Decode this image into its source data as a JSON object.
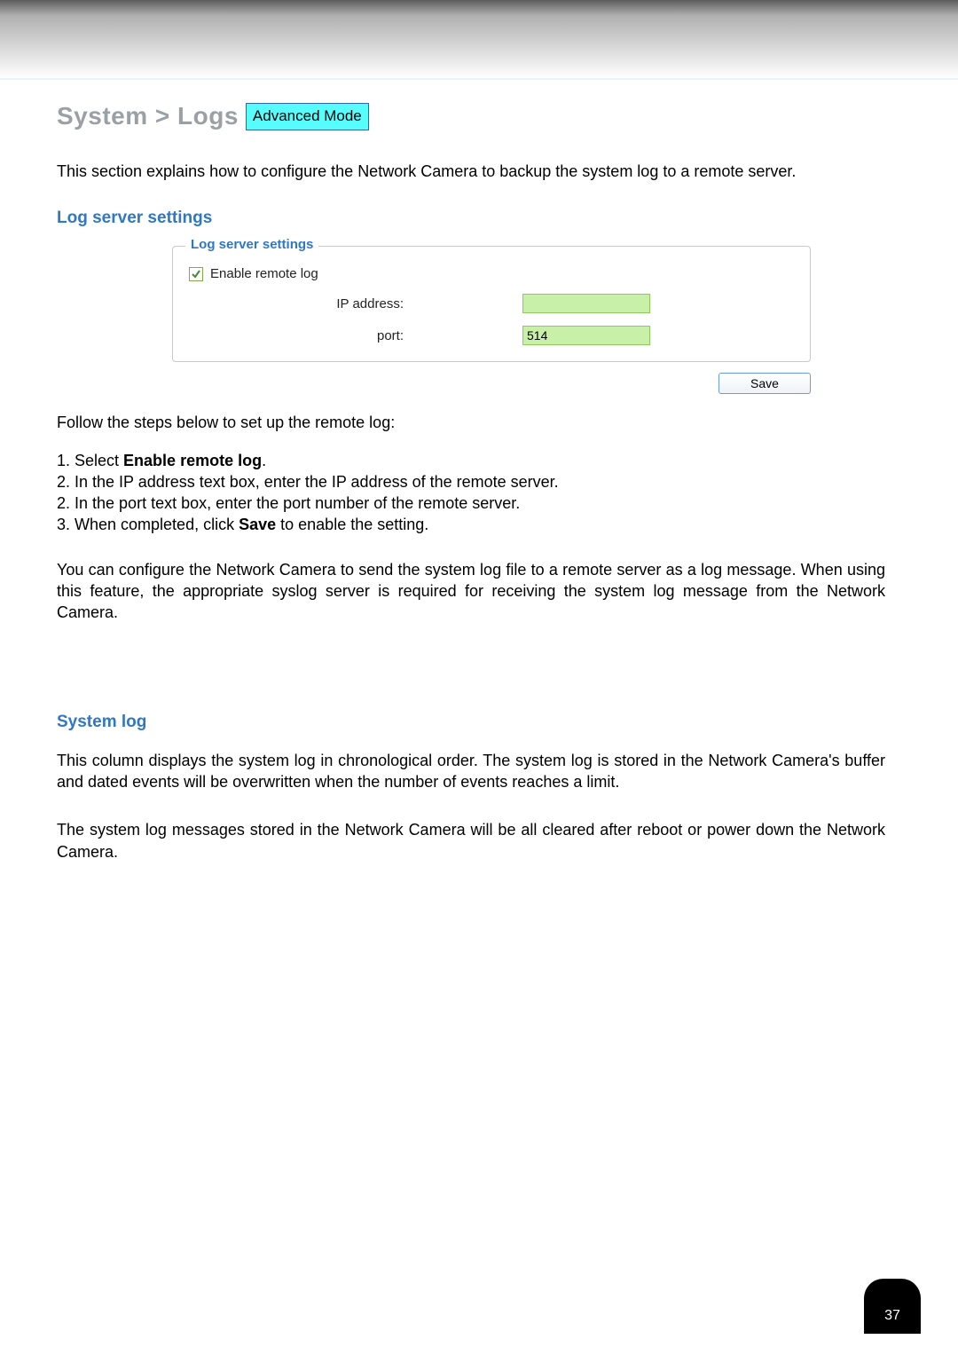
{
  "header": {
    "breadcrumb": "System > Logs",
    "badge": "Advanced Mode"
  },
  "intro": "This section explains how to configure the Network Camera to backup the system log to a remote server.",
  "section1": {
    "title": "Log server settings",
    "fieldset_legend": "Log server settings",
    "checkbox_label": "Enable remote log",
    "checkbox_checked": true,
    "ip_label": "IP address:",
    "ip_value": "",
    "port_label": "port:",
    "port_value": "514",
    "save_button": "Save"
  },
  "steps_intro": "Follow the steps below to set up the remote log:",
  "steps": {
    "s1_prefix": "1. Select ",
    "s1_bold": "Enable remote log",
    "s1_suffix": ".",
    "s2": "2. In the IP address text box, enter the IP address of the remote server.",
    "s3": "2. In the port text box, enter the port number of the remote server.",
    "s4_prefix": "3. When completed, click ",
    "s4_bold": "Save",
    "s4_suffix": " to enable the setting."
  },
  "post_steps": "You can configure the Network Camera to send the system log file to a remote server as a log message. When using this feature, the appropriate syslog server is required for receiving the system log message from the Network Camera.",
  "section2": {
    "title": "System log",
    "p1": "This column displays the system log in chronological order. The system log is stored in the Network Camera's buffer and dated events will be overwritten when the number of events reaches a limit.",
    "p2": "The system log messages stored in the Network Camera will be all cleared after reboot or power down the Network Camera."
  },
  "page_number": "37"
}
